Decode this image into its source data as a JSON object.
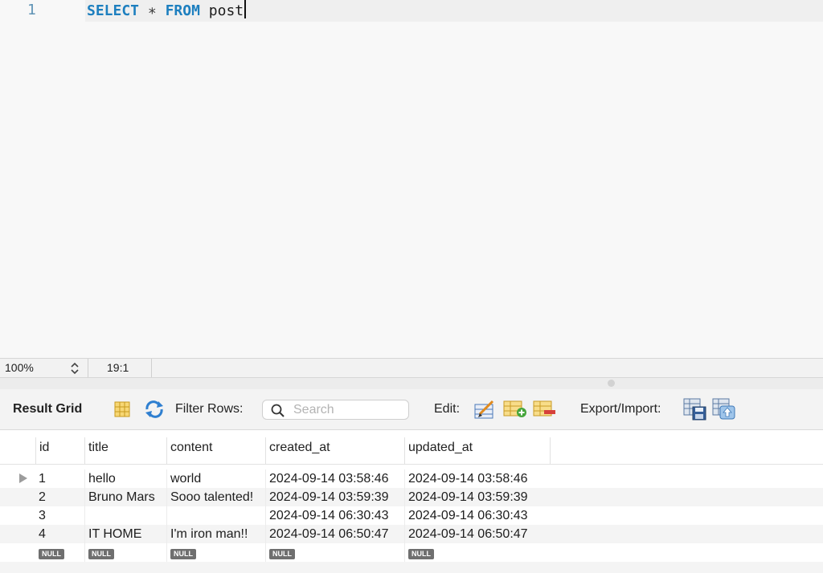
{
  "editor": {
    "line_number": "1",
    "keyword_select": "SELECT",
    "operator_star": "∗",
    "keyword_from": "FROM",
    "table_name": "post"
  },
  "status": {
    "zoom": "100%",
    "cursor_position": "19:1"
  },
  "toolbar": {
    "title": "Result Grid",
    "filter_label": "Filter Rows:",
    "search_placeholder": "Search",
    "edit_label": "Edit:",
    "export_label": "Export/Import:"
  },
  "grid": {
    "columns": [
      "id",
      "title",
      "content",
      "created_at",
      "updated_at"
    ],
    "rows": [
      [
        "1",
        "hello",
        "world",
        "2024-09-14 03:58:46",
        "2024-09-14 03:58:46"
      ],
      [
        "2",
        "Bruno Mars",
        "Sooo talented!",
        "2024-09-14 03:59:39",
        "2024-09-14 03:59:39"
      ],
      [
        "3",
        "",
        "",
        "2024-09-14 06:30:43",
        "2024-09-14 06:30:43"
      ],
      [
        "4",
        "IT HOME",
        "I'm iron man!!",
        "2024-09-14 06:50:47",
        "2024-09-14 06:50:47"
      ]
    ],
    "null_label": "NULL"
  },
  "colors": {
    "keyword": "#1d7fbf",
    "line_number": "#5f93b5",
    "null_badge": "#6f6f6f"
  }
}
